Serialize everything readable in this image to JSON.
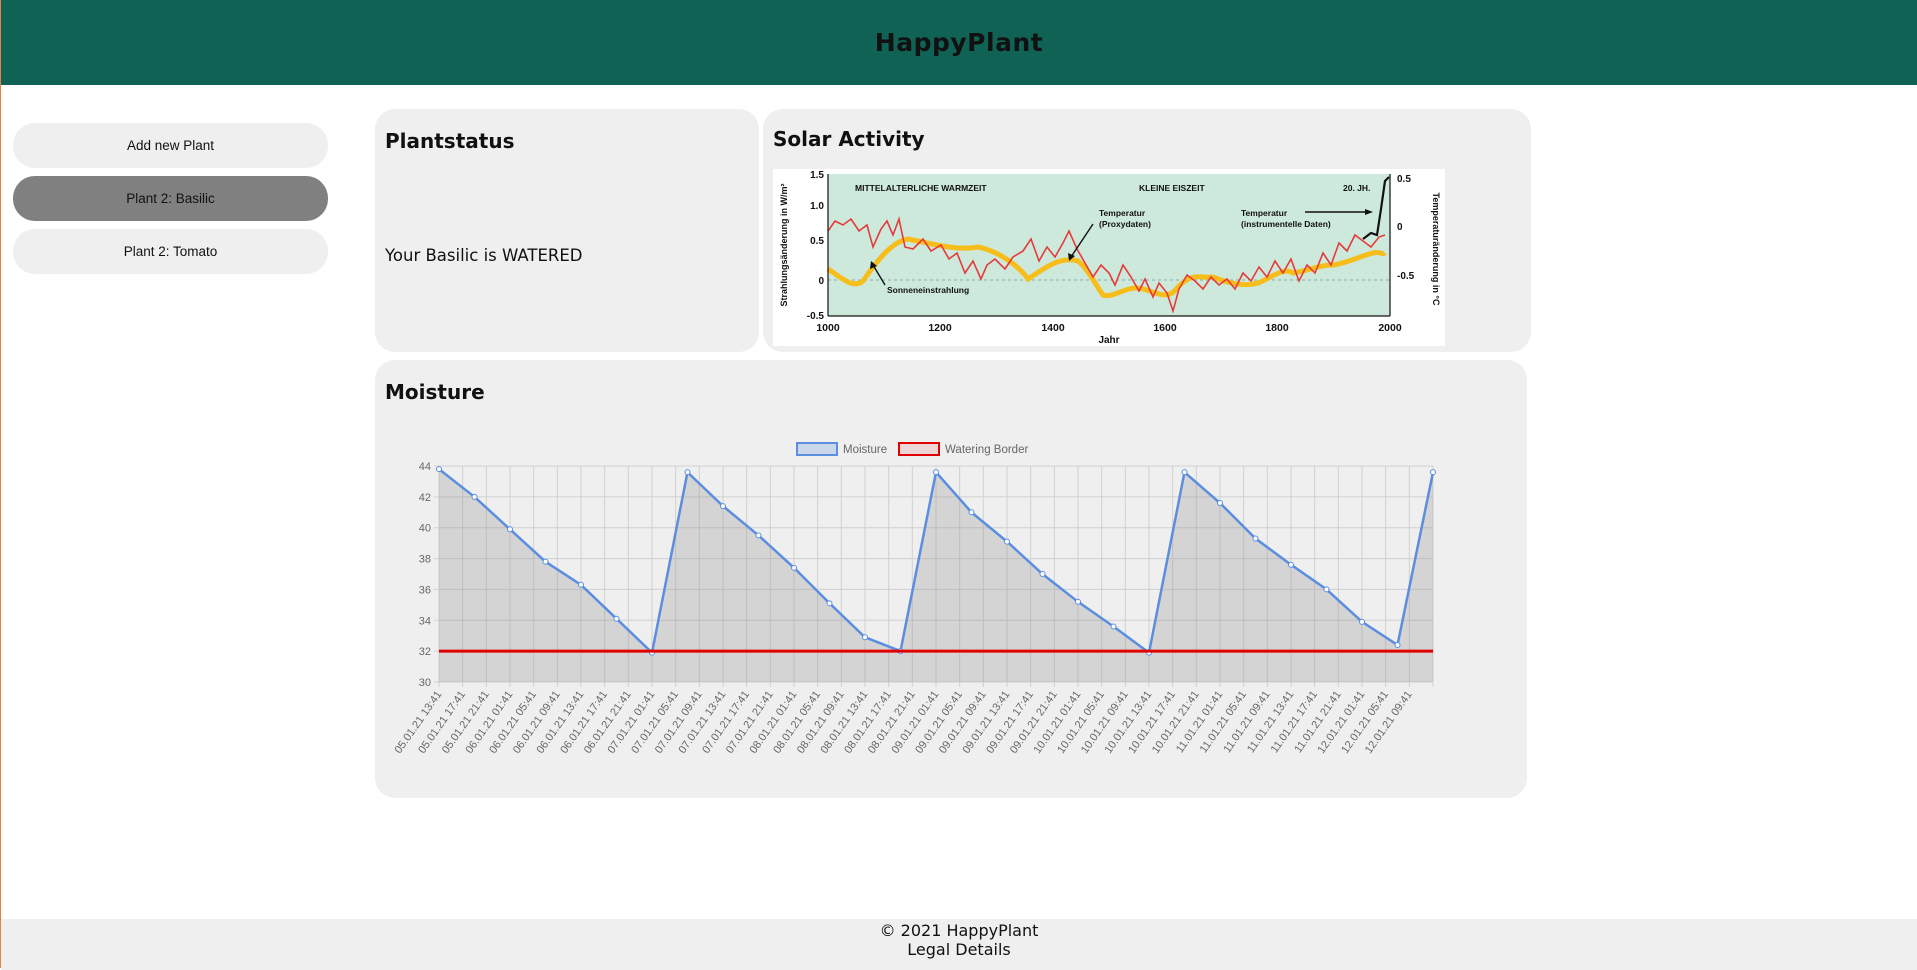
{
  "app": {
    "title": "HappyPlant"
  },
  "sidebar": {
    "items": [
      {
        "label": "Add new Plant",
        "active": false
      },
      {
        "label": "Plant 2: Basilic",
        "active": true
      },
      {
        "label": "Plant 2: Tomato",
        "active": false
      }
    ]
  },
  "plantstatus": {
    "title": "Plantstatus",
    "text": "Your Basilic is WATERED"
  },
  "solar": {
    "title": "Solar Activity",
    "figure": {
      "era_labels": [
        "MITTELALTERLICHE WARMZEIT",
        "KLEINE EISZEIT",
        "20. JH."
      ],
      "annotations": [
        "Temperatur",
        "(Proxydaten)",
        "Temperatur",
        "(instrumentelle Daten)",
        "Sonneneinstrahlung"
      ],
      "left_axis_label": "Strahlungsänderung in W/m²",
      "right_axis_label": "Temperaturänderung in °C",
      "x_label": "Jahr",
      "left_ticks": [
        "1.5",
        "1.0",
        "0.5",
        "0",
        "-0.5"
      ],
      "right_ticks": [
        "0.5",
        "0",
        "-0.5"
      ],
      "x_ticks": [
        "1000",
        "1200",
        "1400",
        "1600",
        "1800",
        "2000"
      ],
      "colors": {
        "background": "#cde9dc",
        "temperature": "#e63a3a",
        "solar": "#f7be1b"
      }
    }
  },
  "moisture": {
    "title": "Moisture"
  },
  "chart_data": {
    "type": "line",
    "title": "",
    "xlabel": "",
    "ylabel": "",
    "ylim": [
      30,
      44
    ],
    "yticks": [
      30,
      32,
      34,
      36,
      38,
      40,
      42,
      44
    ],
    "grid": true,
    "legend": "top-center",
    "categories": [
      "05.01.21 13:41",
      "05.01.21 17:41",
      "05.01.21 21:41",
      "06.01.21 01:41",
      "06.01.21 05:41",
      "06.01.21 09:41",
      "06.01.21 13:41",
      "06.01.21 17:41",
      "06.01.21 21:41",
      "07.01.21 01:41",
      "07.01.21 05:41",
      "07.01.21 09:41",
      "07.01.21 13:41",
      "07.01.21 17:41",
      "07.01.21 21:41",
      "08.01.21 01:41",
      "08.01.21 05:41",
      "08.01.21 09:41",
      "08.01.21 13:41",
      "08.01.21 17:41",
      "08.01.21 21:41",
      "09.01.21 01:41",
      "09.01.21 05:41",
      "09.01.21 09:41",
      "09.01.21 13:41",
      "09.01.21 17:41",
      "09.01.21 21:41",
      "10.01.21 01:41",
      "10.01.21 05:41",
      "10.01.21 09:41",
      "10.01.21 13:41",
      "10.01.21 17:41",
      "10.01.21 21:41",
      "11.01.21 01:41",
      "11.01.21 05:41",
      "11.01.21 09:41",
      "11.01.21 13:41",
      "11.01.21 17:41",
      "11.01.21 21:41",
      "12.01.21 01:41",
      "12.01.21 05:41",
      "12.01.21 09:41"
    ],
    "series": [
      {
        "name": "Moisture",
        "color": "#5b8ee0",
        "fill": "rgba(150,150,150,0.3)",
        "values": [
          43.8,
          42.0,
          39.9,
          37.8,
          36.3,
          34.1,
          31.9,
          43.6,
          41.4,
          39.5,
          37.4,
          35.1,
          32.9,
          32.0,
          43.6,
          41.0,
          39.1,
          37.0,
          35.2,
          33.6,
          31.9,
          43.6,
          41.6,
          39.3,
          37.6,
          36.0,
          33.9,
          32.4,
          43.6
        ]
      },
      {
        "name": "Watering Border",
        "color": "#e00000",
        "values": [
          32,
          32,
          32,
          32,
          32,
          32,
          32,
          32,
          32,
          32,
          32,
          32,
          32,
          32,
          32,
          32,
          32,
          32,
          32,
          32,
          32,
          32,
          32,
          32,
          32,
          32,
          32,
          32,
          32
        ]
      }
    ]
  },
  "footer": {
    "copyright": "© 2021 HappyPlant",
    "legal": "Legal Details"
  }
}
